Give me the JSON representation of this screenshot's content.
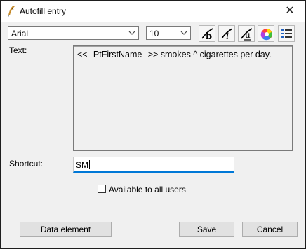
{
  "window": {
    "title": "Autofill entry",
    "close_symbol": "✕",
    "app_icon": "quill-icon"
  },
  "toolbar": {
    "font_family": "Arial",
    "font_size": "10",
    "buttons": [
      {
        "name": "bold-button",
        "icon": "bold-icon",
        "glyph": "b"
      },
      {
        "name": "italic-button",
        "icon": "italic-icon",
        "glyph": "i"
      },
      {
        "name": "underline-button",
        "icon": "underline-icon",
        "glyph": "u"
      },
      {
        "name": "color-button",
        "icon": "color-wheel-icon"
      },
      {
        "name": "list-button",
        "icon": "list-icon"
      }
    ]
  },
  "form": {
    "text_label": "Text:",
    "text_value": "<<--PtFirstName-->> smokes ^ cigarettes per day.",
    "shortcut_label": "Shortcut:",
    "shortcut_value": "SM",
    "available_label": "Available to all users",
    "available_checked": false
  },
  "buttons": {
    "data_element": "Data element",
    "save": "Save",
    "cancel": "Cancel"
  },
  "colors": {
    "focus_border": "#0078d7",
    "window_bg": "#f0f0f0"
  }
}
